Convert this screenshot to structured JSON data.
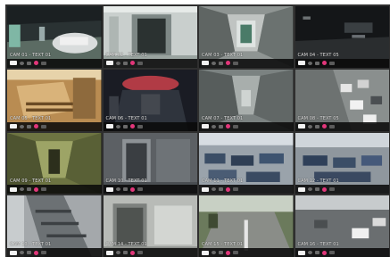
{
  "colors": {
    "background": "#2f2f2f",
    "alarm_icon": "#e2367a"
  },
  "status_icons": [
    "record-icon",
    "network-icon",
    "audio-icon",
    "alarm-icon",
    "motion-icon"
  ],
  "cameras": [
    {
      "label": "CAM 01 - TEXT 01",
      "scene": "garage"
    },
    {
      "label": "CAM 02 - TEXT 01",
      "scene": "hallway-door"
    },
    {
      "label": "CAM 03 - TEXT 01",
      "scene": "corridor-doors"
    },
    {
      "label": "CAM 04 - TEXT 05",
      "scene": "dark-garage"
    },
    {
      "label": "CAM 05 - TEXT 01",
      "scene": "stairwell"
    },
    {
      "label": "CAM 06 - TEXT 01",
      "scene": "red-lights"
    },
    {
      "label": "CAM 07 - TEXT 01",
      "scene": "corridor-long"
    },
    {
      "label": "CAM 08 - TEXT 05",
      "scene": "parking-lot"
    },
    {
      "label": "CAM 09 - TEXT 01",
      "scene": "green-hallway"
    },
    {
      "label": "CAM 10 - TEXT 01",
      "scene": "elevator"
    },
    {
      "label": "CAM 11 - TEXT 01",
      "scene": "office"
    },
    {
      "label": "CAM 12 - TEXT 01",
      "scene": "office-2"
    },
    {
      "label": "CAM 13 - TEXT 01",
      "scene": "stairs-down"
    },
    {
      "label": "CAM 14 - TEXT 01",
      "scene": "entrance"
    },
    {
      "label": "CAM 15 - TEXT 01",
      "scene": "outdoor-road"
    },
    {
      "label": "CAM 16 - TEXT 01",
      "scene": "street-cars"
    }
  ]
}
